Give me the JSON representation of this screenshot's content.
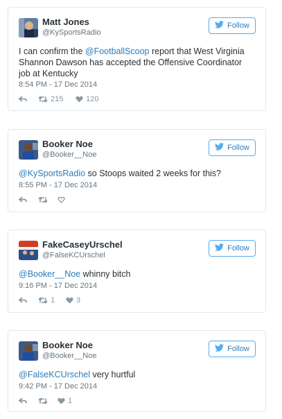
{
  "colors": {
    "accent": "#55acee",
    "link": "#2b7bb9",
    "muted": "#66757f",
    "icon": "#8899a6",
    "border": "#e1e8ed"
  },
  "tweets": [
    {
      "name": "Matt Jones",
      "handle": "@KySportsRadio",
      "follow_label": "Follow",
      "text_before": "I can confirm the ",
      "mention": "@FootballScoop",
      "text_after": " report that West Virginia Shannon Dawson has accepted the Offensive Coordinator job at Kentucky",
      "timestamp": "8:54 PM - 17 Dec 2014",
      "retweets": "215",
      "likes": "120"
    },
    {
      "name": "Booker Noe",
      "handle": "@Booker__Noe",
      "follow_label": "Follow",
      "text_before": "",
      "mention": "@KySportsRadio",
      "text_after": " so Stoops waited 2 weeks for this?",
      "timestamp": "8:55 PM - 17 Dec 2014",
      "retweets": "",
      "likes": ""
    },
    {
      "name": "FakeCaseyUrschel",
      "handle": "@FalseKCUrschel",
      "follow_label": "Follow",
      "text_before": "",
      "mention": "@Booker__Noe",
      "text_after": " whinny bitch",
      "timestamp": "9:16 PM - 17 Dec 2014",
      "retweets": "1",
      "likes": "3"
    },
    {
      "name": "Booker Noe",
      "handle": "@Booker__Noe",
      "follow_label": "Follow",
      "text_before": "",
      "mention": "@FalseKCUrschel",
      "text_after": " very hurtful",
      "timestamp": "9:42 PM - 17 Dec 2014",
      "retweets": "",
      "likes": "1"
    }
  ]
}
